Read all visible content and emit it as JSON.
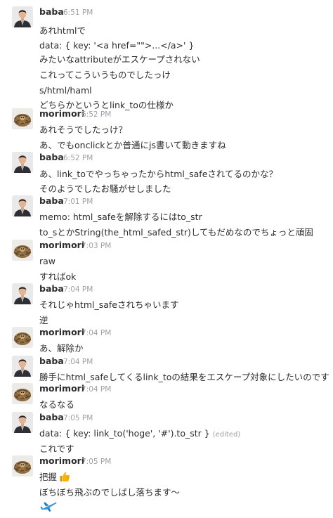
{
  "users": {
    "baba": {
      "name": "baba",
      "avatar_icon": "man-in-suit-avatar-icon"
    },
    "morimori": {
      "name": "morimori",
      "avatar_icon": "bird-nest-avatar-icon"
    }
  },
  "messages": [
    {
      "user": "baba",
      "time": "6:51 PM",
      "lines": [
        "あれhtmlで",
        "data: { key: '<a href=\"\">...</a>' }",
        "みたいなattributeがエスケープされない",
        "これってこういうものでしたっけ",
        "s/html/haml",
        "どちらかというとlink_toの仕様か"
      ]
    },
    {
      "user": "morimori",
      "time": "6:52 PM",
      "lines": [
        "あれそうでしたっけ？",
        "あ、でもonclickとか普通にjs書いて動きますね"
      ]
    },
    {
      "user": "baba",
      "time": "6:52 PM",
      "lines": [
        "あ、link_toでやっちゃったからhtml_safeされてるのかな？",
        "そのようでしたお騒がせしました"
      ]
    },
    {
      "user": "baba",
      "time": "7:01 PM",
      "lines": [
        "memo: html_safeを解除するにはto_str",
        "to_sとかString(the_html_safed_str)してもだめなのでちょっと頑固"
      ]
    },
    {
      "user": "morimori",
      "time": "7:03 PM",
      "lines": [
        "raw",
        "すればok"
      ]
    },
    {
      "user": "baba",
      "time": "7:04 PM",
      "lines": [
        "それじゃhtml_safeされちゃいます",
        "逆"
      ]
    },
    {
      "user": "morimori",
      "time": "7:04 PM",
      "lines": [
        "あ、解除か"
      ]
    },
    {
      "user": "baba",
      "time": "7:04 PM",
      "lines": [
        "勝手にhtml_safeしてくるlink_toの結果をエスケープ対象にしたいのです"
      ]
    },
    {
      "user": "morimori",
      "time": "7:04 PM",
      "lines": [
        "なるなる"
      ]
    },
    {
      "user": "baba",
      "time": "7:05 PM",
      "lines": [
        "data: { key: link_to('hoge', '#').to_str }",
        "これです"
      ],
      "edited_label": "(edited)"
    },
    {
      "user": "morimori",
      "time": "7:05 PM",
      "lines": [
        "把握",
        "ぼちぼち飛ぶのでしばし落ちます〜"
      ],
      "emoji": "thumbs-up-icon",
      "attachment_icon": "airplane-icon"
    }
  ],
  "colors": {
    "name": "#2c2d30",
    "time": "#9e9ea6",
    "text": "#2c2d30",
    "thumb": "#f5b50a",
    "plane": "#3a95d6"
  }
}
